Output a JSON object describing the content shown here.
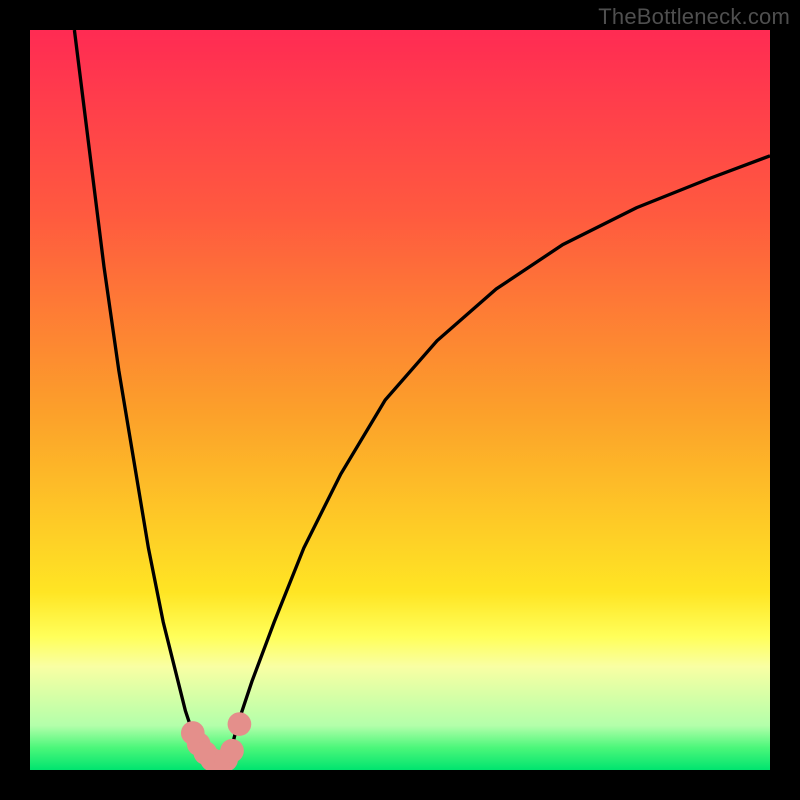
{
  "watermark": "TheBottleneck.com",
  "colors": {
    "frame_bg": "#000000",
    "curve_stroke": "#000000",
    "marker_fill": "#e48f8b",
    "gradient": [
      "#ff2b53",
      "#ff5a3f",
      "#fca12a",
      "#ffe524",
      "#ffff5a",
      "#f9ffa3",
      "#b3ffaa",
      "#4bf77a",
      "#00e46f"
    ]
  },
  "chart_data": {
    "type": "line",
    "title": "",
    "xlabel": "",
    "ylabel": "",
    "x_range": [
      0,
      100
    ],
    "y_range": [
      0,
      100
    ],
    "series": [
      {
        "name": "left-curve",
        "x": [
          6,
          8,
          10,
          12,
          14,
          16,
          18,
          20,
          21,
          22,
          23,
          24,
          25
        ],
        "y": [
          100,
          84,
          68,
          54,
          42,
          30,
          20,
          12,
          8,
          5,
          3,
          1,
          0
        ]
      },
      {
        "name": "right-curve",
        "x": [
          26,
          27,
          28,
          30,
          33,
          37,
          42,
          48,
          55,
          63,
          72,
          82,
          92,
          100
        ],
        "y": [
          0,
          2,
          6,
          12,
          20,
          30,
          40,
          50,
          58,
          65,
          71,
          76,
          80,
          83
        ]
      }
    ],
    "markers": [
      {
        "x": 22.0,
        "y": 5.0,
        "r": 1.6
      },
      {
        "x": 22.8,
        "y": 3.5,
        "r": 1.6
      },
      {
        "x": 23.7,
        "y": 2.3,
        "r": 1.6
      },
      {
        "x": 24.6,
        "y": 1.4,
        "r": 1.6
      },
      {
        "x": 25.5,
        "y": 1.0,
        "r": 1.6
      },
      {
        "x": 26.5,
        "y": 1.4,
        "r": 1.6
      },
      {
        "x": 27.3,
        "y": 2.6,
        "r": 1.6
      },
      {
        "x": 28.3,
        "y": 6.2,
        "r": 1.6
      }
    ]
  }
}
